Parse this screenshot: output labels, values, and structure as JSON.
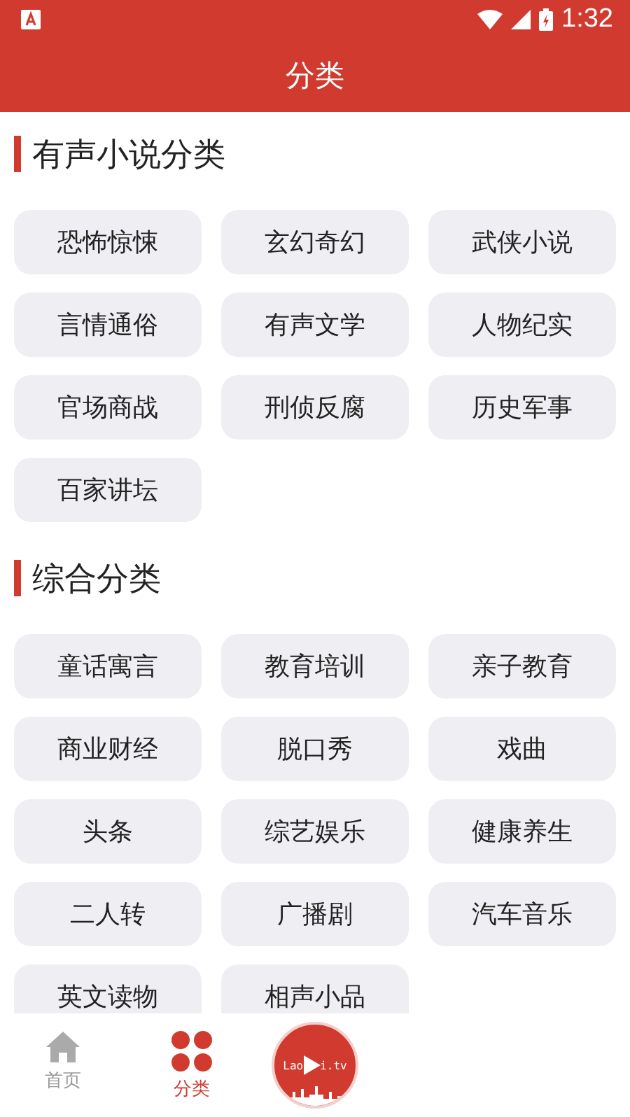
{
  "status_bar": {
    "time": "1:32"
  },
  "header": {
    "title": "分类"
  },
  "sections": [
    {
      "title": "有声小说分类",
      "items": [
        "恐怖惊悚",
        "玄幻奇幻",
        "武侠小说",
        "言情通俗",
        "有声文学",
        "人物纪实",
        "官场商战",
        "刑侦反腐",
        "历史军事",
        "百家讲坛"
      ]
    },
    {
      "title": "综合分类",
      "items": [
        "童话寓言",
        "教育培训",
        "亲子教育",
        "商业财经",
        "脱口秀",
        "戏曲",
        "头条",
        "综艺娱乐",
        "健康养生",
        "二人转",
        "广播剧",
        "汽车音乐",
        "英文读物",
        "相声小品"
      ]
    }
  ],
  "bottom_nav": [
    {
      "kind": "home",
      "label": "首页",
      "selected": false
    },
    {
      "kind": "grid",
      "label": "分类",
      "selected": true
    }
  ],
  "logo": {
    "text_before": "Lao",
    "text_after": "i.tv"
  }
}
